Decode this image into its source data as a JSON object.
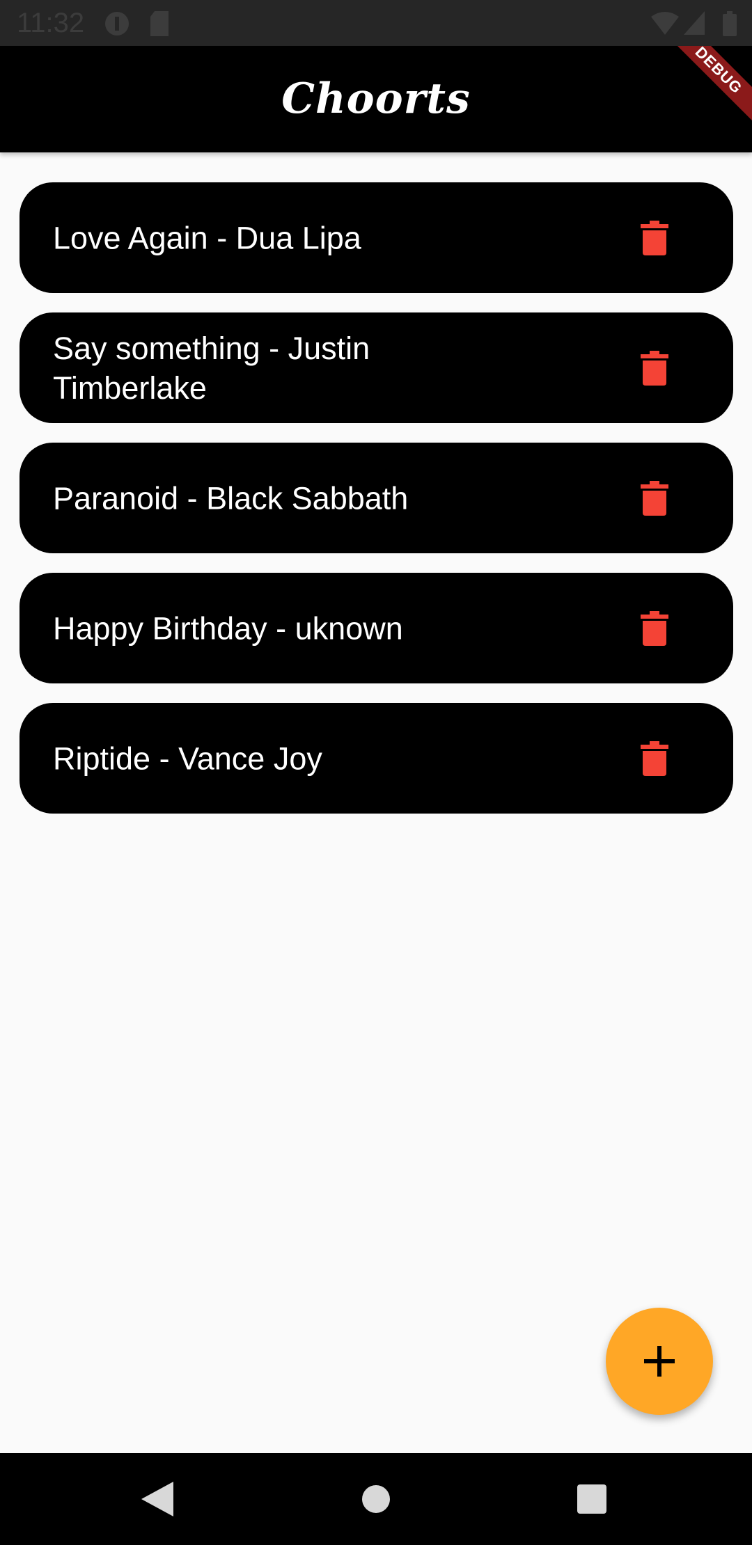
{
  "status_bar": {
    "time": "11:32",
    "icons": [
      "app-notification-icon",
      "sd-card-icon",
      "wifi-icon",
      "signal-icon",
      "battery-icon"
    ]
  },
  "app_bar": {
    "title": "Choorts",
    "debug_banner": "DEBUG"
  },
  "songs": [
    {
      "title": "Love Again - Dua Lipa"
    },
    {
      "title": "Say something - Justin Timberlake"
    },
    {
      "title": "Paranoid - Black Sabbath"
    },
    {
      "title": "Happy Birthday - uknown"
    },
    {
      "title": "Riptide - Vance Joy"
    }
  ],
  "icons": {
    "delete": "trash-icon",
    "add": "plus-icon"
  },
  "colors": {
    "card_bg": "#000000",
    "delete_icon": "#f44336",
    "fab_bg": "#ffa726",
    "app_bar_bg": "#000000",
    "page_bg": "#fafafa"
  },
  "nav_bar": {
    "buttons": [
      "back-icon",
      "home-icon",
      "recents-icon"
    ]
  }
}
